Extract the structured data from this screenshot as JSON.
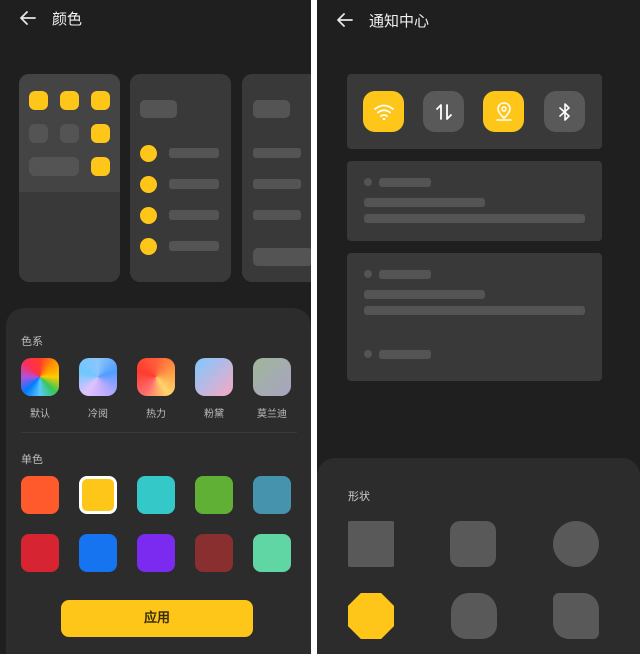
{
  "left_screen": {
    "title": "颜色",
    "color_series_label": "色系",
    "color_series": [
      {
        "label": "默认",
        "gradient": "conic-gradient(#ff3b30, #ff9500, #ffcc00, #34c759, #5ac8fa, #007aff, #af52de, #ff2d55, #ff3b30)"
      },
      {
        "label": "冷阅",
        "gradient": "conic-gradient(#8ec5fc, #4f9dff, #b8a9ff, #e0c3fc, #6ec6ff, #8ec5fc)"
      },
      {
        "label": "热力",
        "gradient": "conic-gradient(#ff5e3a, #ff9a44, #ffd56b, #ff6b6b, #ff3b30, #ff5e3a)"
      },
      {
        "label": "粉黛",
        "gradient": "linear-gradient(135deg, #7fc8ff, #f7a8c4)"
      },
      {
        "label": "莫兰迪",
        "gradient": "linear-gradient(135deg, #9fb79a, #a8a3c2)"
      }
    ],
    "solid_label": "单色",
    "solid_colors": [
      "#ff5a2c",
      "#ffc61a",
      "#35c8c8",
      "#5fb034",
      "#4593ad",
      "#d62432",
      "#1774f0",
      "#7b2bf0",
      "#8a2f2f",
      "#5fd6a3"
    ],
    "selected_color": "#ffc61a",
    "apply_label": "应用"
  },
  "right_screen": {
    "title": "通知中心",
    "quick_tiles": [
      {
        "icon": "wifi-icon",
        "on": true
      },
      {
        "icon": "data-transfer-icon",
        "on": false
      },
      {
        "icon": "location-icon",
        "on": true
      },
      {
        "icon": "bluetooth-icon",
        "on": false
      }
    ],
    "shape_label": "形状",
    "shapes": [
      {
        "name": "square",
        "selected": false
      },
      {
        "name": "rounded-square",
        "selected": false
      },
      {
        "name": "circle",
        "selected": false
      },
      {
        "name": "octagon",
        "selected": true
      },
      {
        "name": "squircle",
        "selected": false
      },
      {
        "name": "teardrop-square",
        "selected": false
      }
    ],
    "accent": "#ffc61a"
  }
}
